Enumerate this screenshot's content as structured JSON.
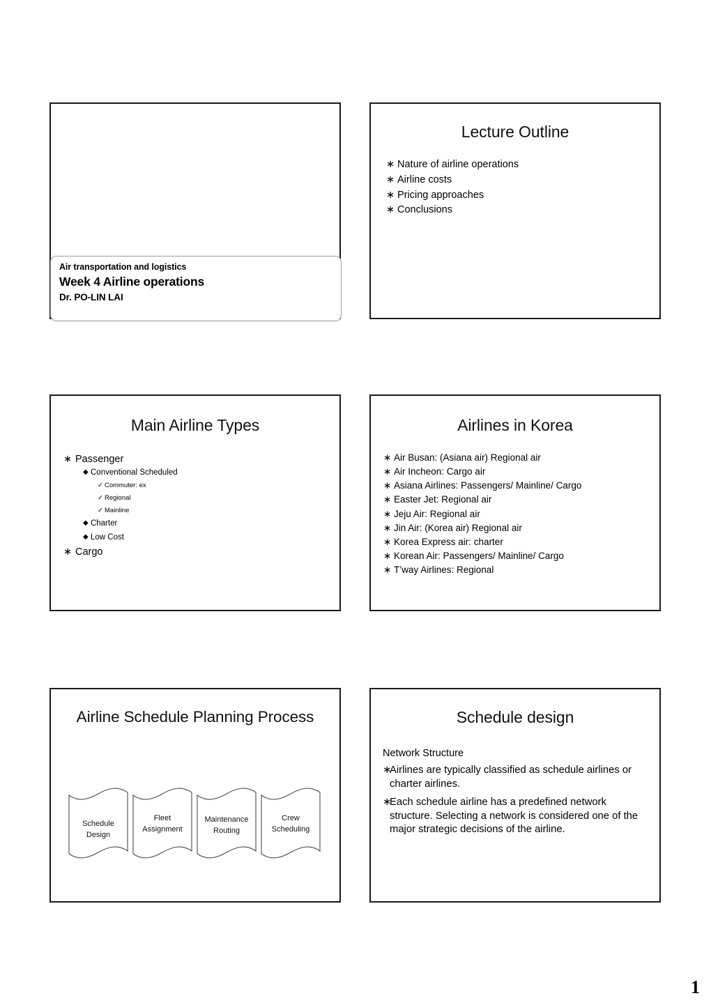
{
  "document": {
    "page_number": "1"
  },
  "slides": [
    {
      "id": "title-page",
      "name": "title-slide",
      "banner": {
        "course": "Air transportation and logistics",
        "topic": "Week 4  Airline operations",
        "lecturer": "Dr. PO-LIN LAI"
      }
    },
    {
      "id": "lecture-outline",
      "name": "lecture-outline-slide",
      "title": "Lecture Outline",
      "bullet_mark": "∗",
      "items": [
        "Nature of airline operations",
        "Airline costs",
        "Pricing approaches",
        "Conclusions"
      ]
    },
    {
      "id": "main-airline-types",
      "name": "main-airline-types-slide",
      "title": "Main Airline Types",
      "marks": {
        "level1": "∗",
        "level2": "◆",
        "level3": "✓"
      },
      "items": [
        {
          "level": 1,
          "text": "Passenger"
        },
        {
          "level": 2,
          "text": "Conventional Scheduled"
        },
        {
          "level": 3,
          "text": "Commuter: ex"
        },
        {
          "level": 3,
          "text": "Regional"
        },
        {
          "level": 3,
          "text": "Mainline"
        },
        {
          "level": 2,
          "text": "Charter"
        },
        {
          "level": 2,
          "text": "Low Cost"
        },
        {
          "level": 1,
          "text": "Cargo"
        }
      ]
    },
    {
      "id": "airlines-in-korea",
      "name": "airlines-in-korea-slide",
      "title": "Airlines in Korea",
      "bullet_mark": "∗",
      "items": [
        "Air Busan: (Asiana air) Regional air",
        "Air Incheon: Cargo air",
        "Asiana Airlines: Passengers/ Mainline/ Cargo",
        "Easter Jet: Regional air",
        "Jeju Air: Regional air",
        "Jin Air: (Korea air) Regional air",
        "Korea Express air: charter",
        "Korean Air: Passengers/ Mainline/ Cargo",
        "T’way Airlines: Regional"
      ]
    },
    {
      "id": "airline-schedule-planning-process",
      "name": "schedule-planning-slide",
      "title": "Airline Schedule Planning Process",
      "flow_steps": [
        {
          "line1": "Schedule",
          "line2": "Design"
        },
        {
          "line1": "Fleet",
          "line2": "Assignment"
        },
        {
          "line1": "Maintenance",
          "line2": "Routing"
        },
        {
          "line1": "Crew",
          "line2": "Scheduling"
        }
      ]
    },
    {
      "id": "schedule-design",
      "name": "schedule-design-slide",
      "title": "Schedule design",
      "bullet_mark": "∗",
      "heading": "Network Structure",
      "paragraphs": [
        "Airlines are typically classified as schedule airlines or charter airlines.",
        "Each schedule airline has a predefined network structure. Selecting  a network is considered one of the major strategic decisions of the airline."
      ]
    }
  ]
}
